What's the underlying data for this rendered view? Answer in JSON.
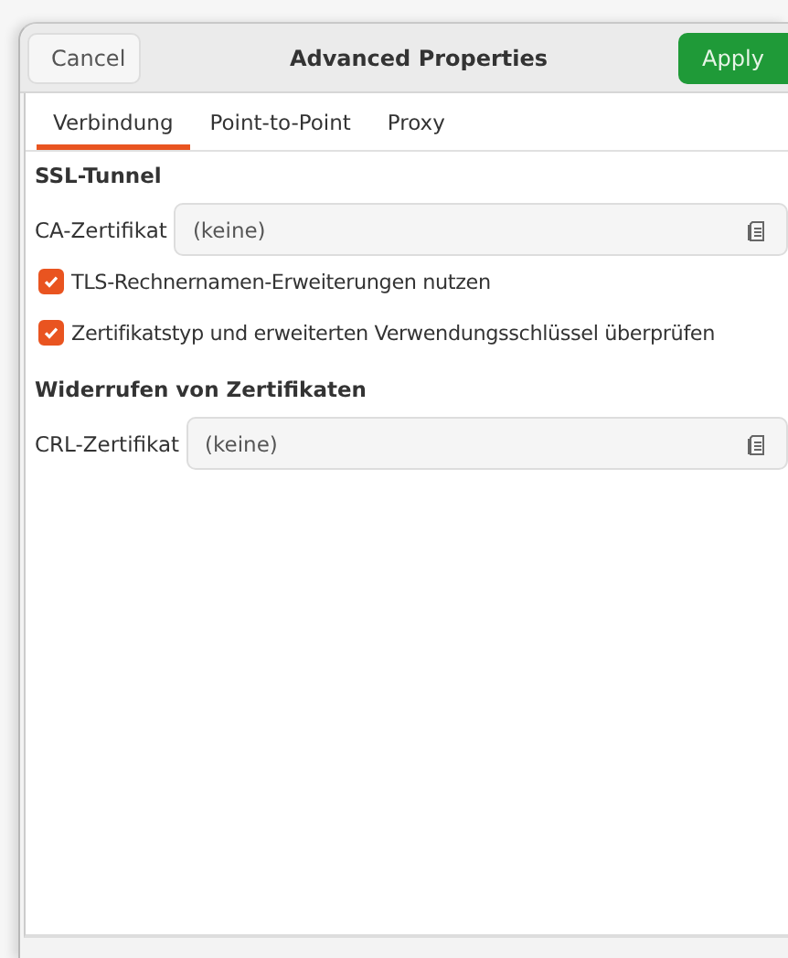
{
  "window": {
    "title": "Advanced Properties"
  },
  "header_buttons": [
    {
      "label": "Cancel",
      "kind": "plain"
    },
    {
      "label": "Apply",
      "kind": "suggested"
    }
  ],
  "tabs": [
    {
      "label": "Verbindung",
      "selected": true
    },
    {
      "label": "Point-to-Point",
      "selected": false
    },
    {
      "label": "Proxy",
      "selected": false
    }
  ],
  "sections": [
    {
      "title": "SSL-Tunnel",
      "items": [
        {
          "kind": "file",
          "label": "CA-Zertifikat",
          "value": "(keine)"
        },
        {
          "kind": "checkbox",
          "label": "TLS-Rechnernamen-Erweiterungen nutzen",
          "checked": true
        },
        {
          "kind": "checkbox",
          "label": "Zertifikatstyp und erweiterten Verwendungsschlüssel überprüfen",
          "checked": true
        }
      ]
    },
    {
      "title": "Widerrufen von Zertifikaten",
      "items": [
        {
          "kind": "file",
          "label": "CRL-Zertifikat",
          "value": "(keine)"
        }
      ]
    }
  ]
}
